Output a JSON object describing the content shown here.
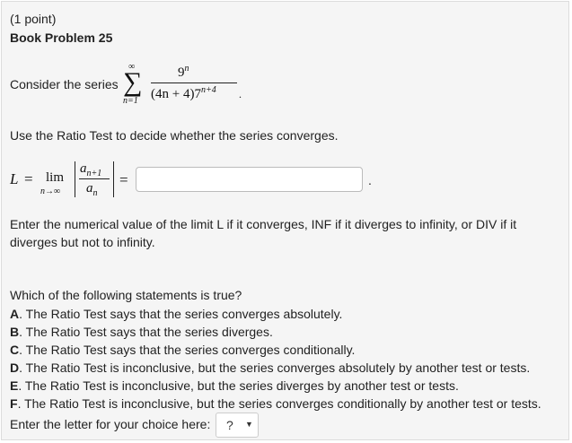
{
  "header": {
    "points": "(1 point)",
    "problem_title": "Book Problem 25"
  },
  "series": {
    "intro": "Consider the series",
    "sum_upper": "∞",
    "sum_lower": "n=1",
    "numerator_base": "9",
    "numerator_exp": "n",
    "denominator_factor": "(4n + 4)7",
    "denominator_exp": "n+4",
    "end_punct": "."
  },
  "instruction": "Use the Ratio Test to decide whether the series converges.",
  "limit": {
    "lhs": "L",
    "eq": "=",
    "lim": "lim",
    "lim_sub": "n→∞",
    "num": "a",
    "num_sub": "n+1",
    "den": "a",
    "den_sub": "n",
    "eq2": "=",
    "input_value": "",
    "end_punct": "."
  },
  "limit_help": {
    "line1": "Enter the numerical value of the limit L if it converges, INF if it diverges to infinity, or DIV if it",
    "line2": "diverges but not to infinity."
  },
  "question": "Which of the following statements is true?",
  "options": [
    {
      "letter": "A",
      "text": ". The Ratio Test says that the series converges absolutely."
    },
    {
      "letter": "B",
      "text": ". The Ratio Test says that the series diverges."
    },
    {
      "letter": "C",
      "text": ". The Ratio Test says that the series converges conditionally."
    },
    {
      "letter": "D",
      "text": ". The Ratio Test is inconclusive, but the series converges absolutely by another test or tests."
    },
    {
      "letter": "E",
      "text": ". The Ratio Test is inconclusive, but the series diverges by another test or tests."
    },
    {
      "letter": "F",
      "text": ". The Ratio Test is inconclusive, but the series converges conditionally by another test or tests."
    }
  ],
  "choice": {
    "label": "Enter the letter for your choice here:",
    "selected": "?",
    "caret": "▼"
  }
}
